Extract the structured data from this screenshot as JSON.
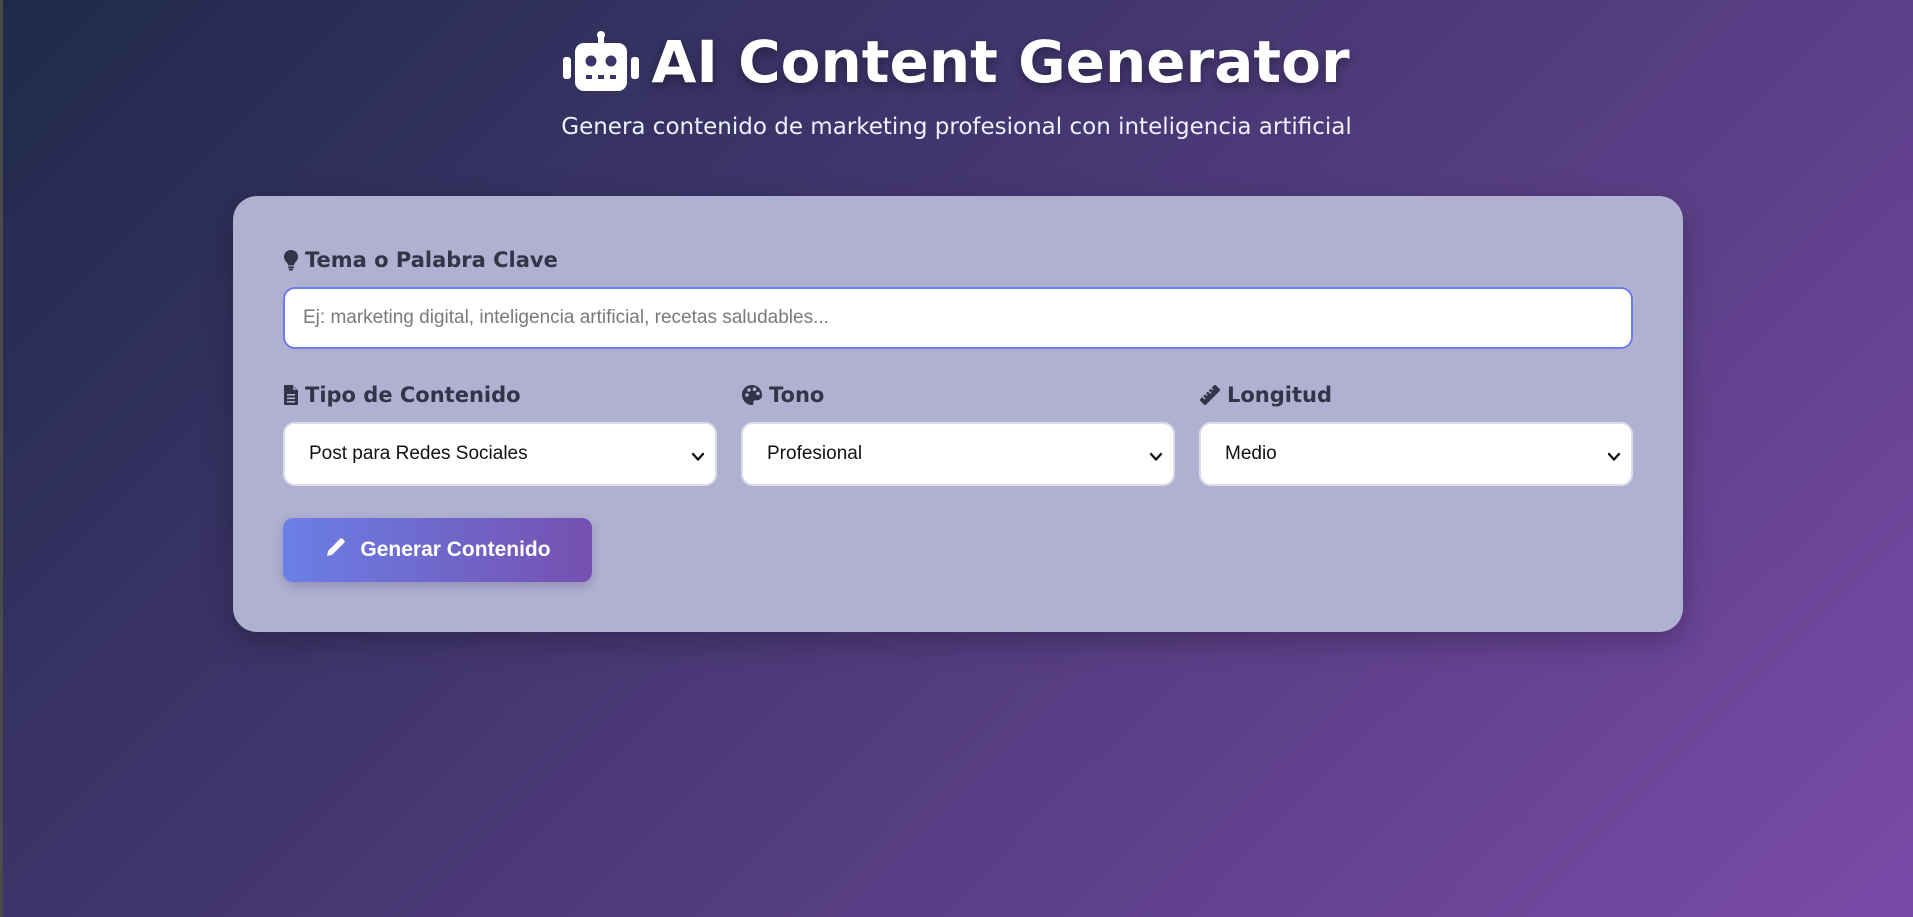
{
  "header": {
    "title": "AI Content Generator",
    "subtitle": "Genera contenido de marketing profesional con inteligencia artificial",
    "icon": "robot-icon"
  },
  "form": {
    "topic": {
      "label": "Tema o Palabra Clave",
      "icon": "lightbulb-icon",
      "value": "",
      "placeholder": "Ej: marketing digital, inteligencia artificial, recetas saludables..."
    },
    "content_type": {
      "label": "Tipo de Contenido",
      "icon": "document-icon",
      "selected": "Post para Redes Sociales"
    },
    "tone": {
      "label": "Tono",
      "icon": "palette-icon",
      "selected": "Profesional"
    },
    "length": {
      "label": "Longitud",
      "icon": "ruler-icon",
      "selected": "Medio"
    },
    "generate_button": {
      "label": "Generar Contenido",
      "icon": "pencil-icon"
    }
  },
  "colors": {
    "accent_start": "#6b7fe6",
    "accent_end": "#7550b0",
    "card_bg": "#b0b1d0",
    "input_focus_border": "#6f7bea"
  }
}
